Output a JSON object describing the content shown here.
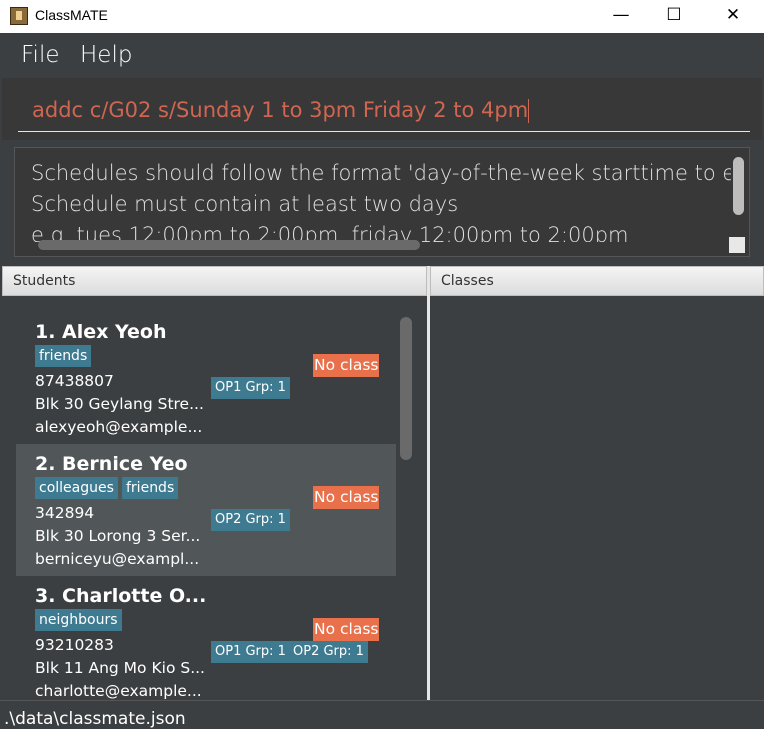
{
  "window": {
    "title": "ClassMATE",
    "minimize_glyph": "—",
    "maximize_glyph": "☐",
    "close_glyph": "✕"
  },
  "menu": {
    "file_label": "File",
    "help_label": "Help"
  },
  "command": {
    "value": "addc c/G02 s/Sunday 1 to 3pm Friday 2 to 4pm"
  },
  "result": {
    "text": "Schedules should follow the format 'day-of-the-week starttime to endtime\nSchedule must contain at least two days\ne.g. tues 12:00pm to 2:00pm, friday 12:00pm to 2:00pm"
  },
  "students_panel": {
    "header": "Students",
    "cards": [
      {
        "index_name": "1.  Alex Yeoh",
        "tags": [
          "friends"
        ],
        "phone": "87438807",
        "address": "Blk 30 Geylang Stre...",
        "email": "alexyeoh@example...",
        "groups": [
          "OP1 Grp: 1"
        ],
        "class_status": "No class"
      },
      {
        "index_name": "2.  Bernice Yeo",
        "tags": [
          "colleagues",
          "friends"
        ],
        "phone": "342894",
        "address": "Blk 30 Lorong 3 Ser...",
        "email": "berniceyu@exampl...",
        "groups": [
          "OP2 Grp: 1"
        ],
        "class_status": "No class"
      },
      {
        "index_name": "3.  Charlotte O...",
        "tags": [
          "neighbours"
        ],
        "phone": "93210283",
        "address": "Blk 11 Ang Mo Kio S...",
        "email": "charlotte@example...",
        "groups": [
          "OP1 Grp: 1",
          "OP2 Grp: 1"
        ],
        "class_status": "No class"
      }
    ]
  },
  "classes_panel": {
    "header": "Classes"
  },
  "status": {
    "path": ".\\data\\classmate.json"
  },
  "colors": {
    "accent": "#3e7b91",
    "no_class": "#e8704a",
    "command_text": "#d06651",
    "background": "#3c3f41"
  }
}
